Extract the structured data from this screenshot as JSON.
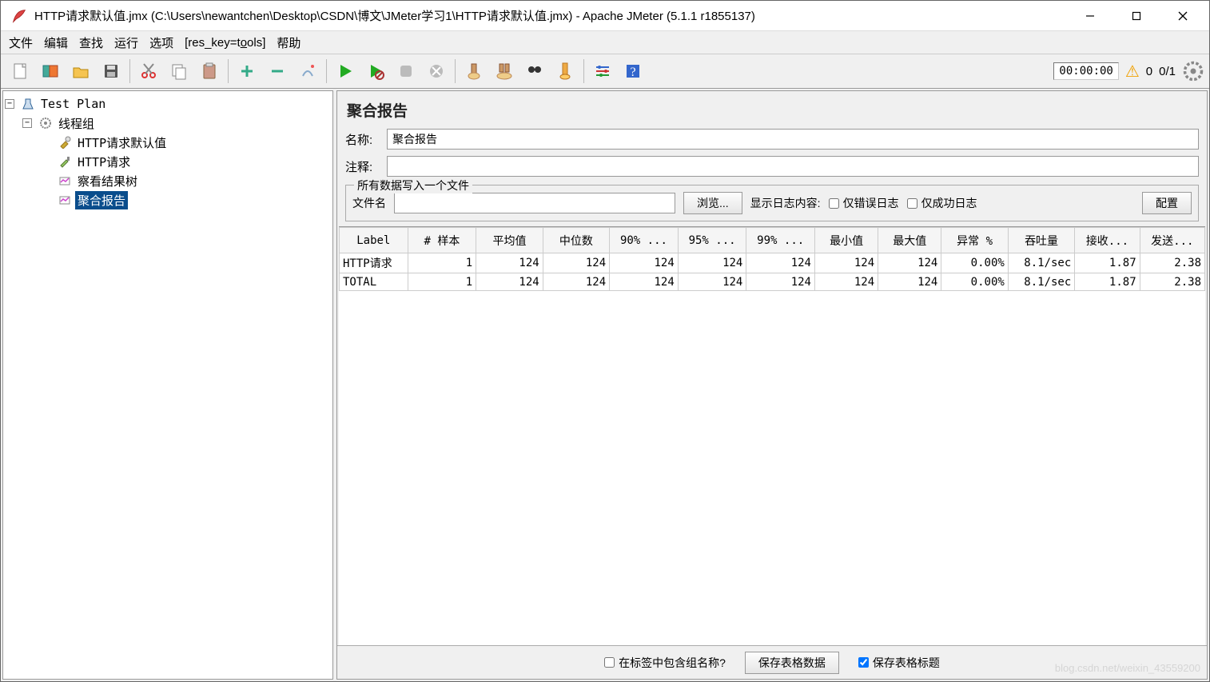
{
  "window": {
    "title": "HTTP请求默认值.jmx (C:\\Users\\newantchen\\Desktop\\CSDN\\博文\\JMeter学习1\\HTTP请求默认值.jmx) - Apache JMeter (5.1.1 r1855137)"
  },
  "menubar": {
    "file": "文件",
    "edit": "编辑",
    "search": "查找",
    "run": "运行",
    "options": "选项",
    "tools": "[res_key=tools]",
    "help": "帮助"
  },
  "toolbar_status": {
    "timer": "00:00:00",
    "warn_count": "0",
    "thread_status": "0/1"
  },
  "tree": {
    "root": "Test Plan",
    "thread_group": "线程组",
    "http_defaults": "HTTP请求默认值",
    "http_request": "HTTP请求",
    "view_results": "察看结果树",
    "aggregate": "聚合报告"
  },
  "panel": {
    "title": "聚合报告",
    "name_label": "名称:",
    "name_value": "聚合报告",
    "comment_label": "注释:",
    "comment_value": "",
    "file_legend": "所有数据写入一个文件",
    "filename_label": "文件名",
    "filename_value": "",
    "browse_btn": "浏览...",
    "log_display_label": "显示日志内容:",
    "errors_only": "仅错误日志",
    "success_only": "仅成功日志",
    "configure_btn": "配置"
  },
  "table": {
    "headers": [
      "Label",
      "# 样本",
      "平均值",
      "中位数",
      "90% ...",
      "95% ...",
      "99% ...",
      "最小值",
      "最大值",
      "异常 %",
      "吞吐量",
      "接收...",
      "发送..."
    ],
    "rows": [
      {
        "label": "HTTP请求",
        "samples": "1",
        "avg": "124",
        "median": "124",
        "p90": "124",
        "p95": "124",
        "p99": "124",
        "min": "124",
        "max": "124",
        "err": "0.00%",
        "throughput": "8.1/sec",
        "recv": "1.87",
        "sent": "2.38"
      },
      {
        "label": "TOTAL",
        "samples": "1",
        "avg": "124",
        "median": "124",
        "p90": "124",
        "p95": "124",
        "p99": "124",
        "min": "124",
        "max": "124",
        "err": "0.00%",
        "throughput": "8.1/sec",
        "recv": "1.87",
        "sent": "2.38"
      }
    ]
  },
  "bottom": {
    "include_group": "在标签中包含组名称?",
    "save_data": "保存表格数据",
    "save_header": "保存表格标题"
  },
  "watermark": "blog.csdn.net/weixin_43559200"
}
